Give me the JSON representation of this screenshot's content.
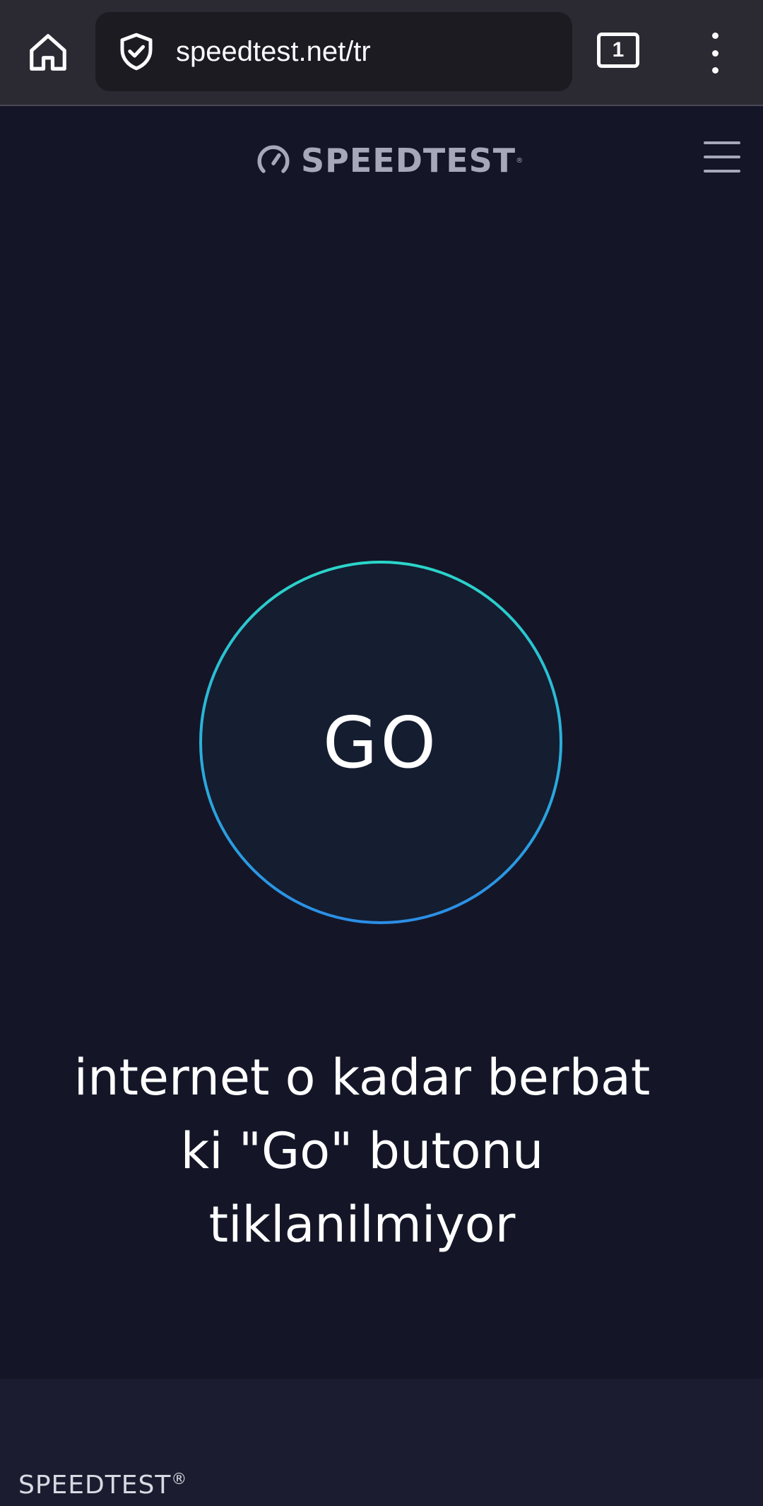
{
  "browser": {
    "url": "speedtest.net/tr",
    "tab_count": "1",
    "icons": [
      "home-icon",
      "shield-check-icon",
      "tabs-icon",
      "more-vertical-icon"
    ]
  },
  "header": {
    "brand": "SPEEDTEST",
    "brand_mark": "®",
    "icons": [
      "speedometer-icon",
      "hamburger-menu-icon"
    ]
  },
  "main": {
    "go_label": "GO",
    "caption_lines": [
      "internet o kadar berbat",
      "ki \"Go\" butonu",
      "tiklanilmiyor"
    ]
  },
  "footer": {
    "brand": "SPEEDTEST",
    "mark": "®"
  },
  "colors": {
    "page_bg": "#141628",
    "browser_bg": "#2b2a33",
    "ring_top": "#2bd6c9",
    "ring_bottom": "#2b8ee6",
    "brand_gray": "#a6a7b8"
  }
}
